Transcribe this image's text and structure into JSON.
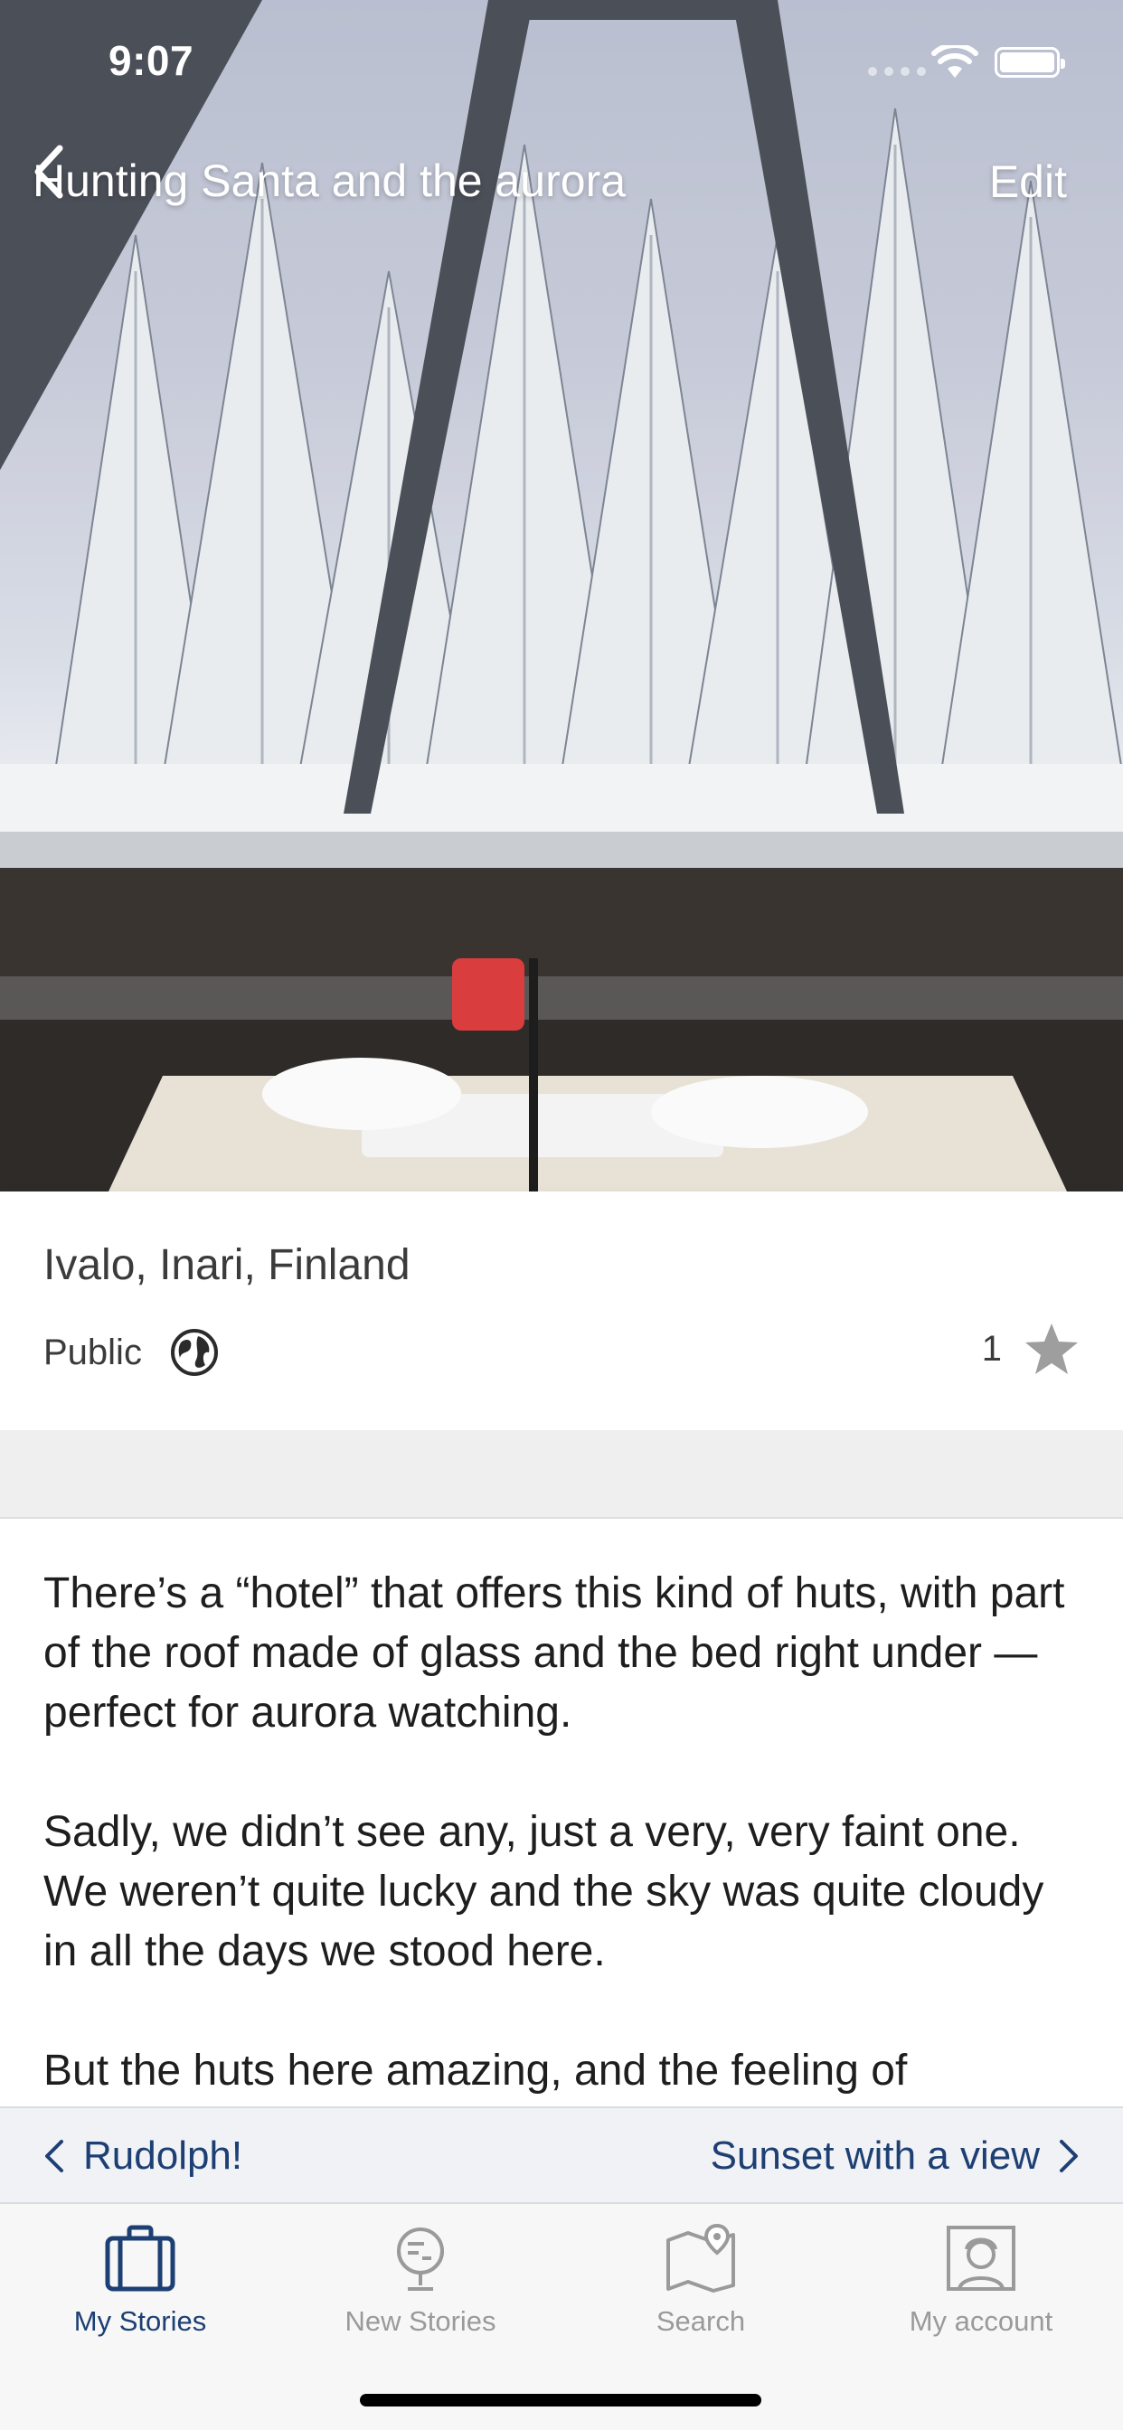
{
  "status_bar": {
    "time": "9:07"
  },
  "nav": {
    "back_title": "Hunting Santa and the aurora",
    "edit_label": "Edit"
  },
  "hero": {
    "image_description_icon": "photo-glass-igloo-snowy-forest"
  },
  "info": {
    "location": "Ivalo, Inari, Finland",
    "privacy": "Public",
    "star_count": "1"
  },
  "story": {
    "paragraphs": [
      "There’s a “hotel” that offers this kind of huts, with part of the roof made of glass and the bed right under — perfect for aurora watching.",
      "Sadly, we didn’t see any, just a very, very faint one. We weren’t quite lucky and the sky was quite cloudy in all the days we stood here.",
      "But the huts here amazing, and the feeling of"
    ]
  },
  "pager": {
    "prev_label": "Rudolph!",
    "next_label": "Sunset with a view"
  },
  "tabs": [
    {
      "label": "My Stories",
      "icon": "suitcase-icon",
      "active": true
    },
    {
      "label": "New Stories",
      "icon": "globe-stand-icon",
      "active": false
    },
    {
      "label": "Search",
      "icon": "map-pin-icon",
      "active": false
    },
    {
      "label": "My account",
      "icon": "person-portrait-icon",
      "active": false
    }
  ],
  "colors": {
    "accent": "#1d3f73",
    "inactive_tab": "#9a9a9a",
    "text": "#1e1e1e"
  }
}
